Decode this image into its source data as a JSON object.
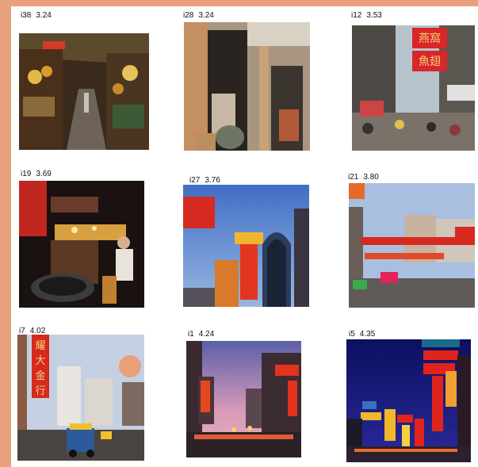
{
  "images": [
    {
      "id": "i38",
      "score": "3.24",
      "scene": "market-alley"
    },
    {
      "id": "i28",
      "score": "3.24",
      "scene": "shophouse-doorway"
    },
    {
      "id": "i12",
      "score": "3.53",
      "scene": "busy-street-signs"
    },
    {
      "id": "i19",
      "score": "3.69",
      "scene": "night-food-stall"
    },
    {
      "id": "i27",
      "score": "3.76",
      "scene": "dusk-gold-sign"
    },
    {
      "id": "i21",
      "score": "3.80",
      "scene": "street-banner"
    },
    {
      "id": "i7",
      "score": "4.02",
      "scene": "street-tuktuk"
    },
    {
      "id": "i1",
      "score": "4.24",
      "scene": "pink-dusk-street"
    },
    {
      "id": "i5",
      "score": "4.35",
      "scene": "neon-night-street"
    }
  ],
  "sign_text": {
    "i12_top": "燕窩",
    "i12_bottom": "魚翅",
    "i7_vertical": [
      "耀",
      "大",
      "金",
      "行"
    ]
  },
  "colors": {
    "frame": "#e9a07c",
    "neon_red": "#e0241b",
    "neon_gold": "#f2b72a"
  }
}
